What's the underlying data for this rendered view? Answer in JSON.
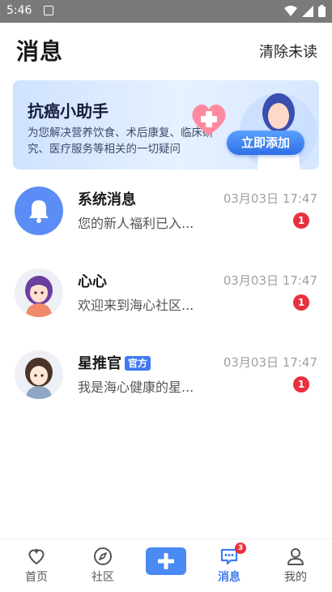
{
  "status_bar": {
    "time": "5:46"
  },
  "header": {
    "title": "消息",
    "clear_label": "清除未读"
  },
  "banner": {
    "title": "抗癌小助手",
    "description": "为您解决营养饮食、术后康复、临床研究、医疗服务等相关的一切疑问",
    "button_label": "立即添加"
  },
  "messages": [
    {
      "name": "系统消息",
      "time": "03月03日 17:47",
      "preview": "您的新人福利已入...",
      "unread": "1",
      "avatar": "bell-icon"
    },
    {
      "name": "心心",
      "time": "03月03日 17:47",
      "preview": "欢迎来到海心社区...",
      "unread": "1",
      "avatar": "girl-avatar"
    },
    {
      "name": "星推官",
      "tag": "官方",
      "time": "03月03日 17:47",
      "preview": "我是海心健康的星...",
      "unread": "1",
      "avatar": "girl-avatar-2"
    }
  ],
  "bottom_nav": {
    "items": [
      {
        "label": "首页",
        "icon": "home-icon"
      },
      {
        "label": "社区",
        "icon": "compass-icon"
      },
      {
        "label": "",
        "icon": "plus-icon"
      },
      {
        "label": "消息",
        "icon": "message-icon",
        "badge": "3"
      },
      {
        "label": "我的",
        "icon": "profile-icon"
      }
    ]
  },
  "colors": {
    "accent": "#3f7bf0",
    "badge": "#e8303f",
    "status_bar": "#7a7a7a"
  }
}
